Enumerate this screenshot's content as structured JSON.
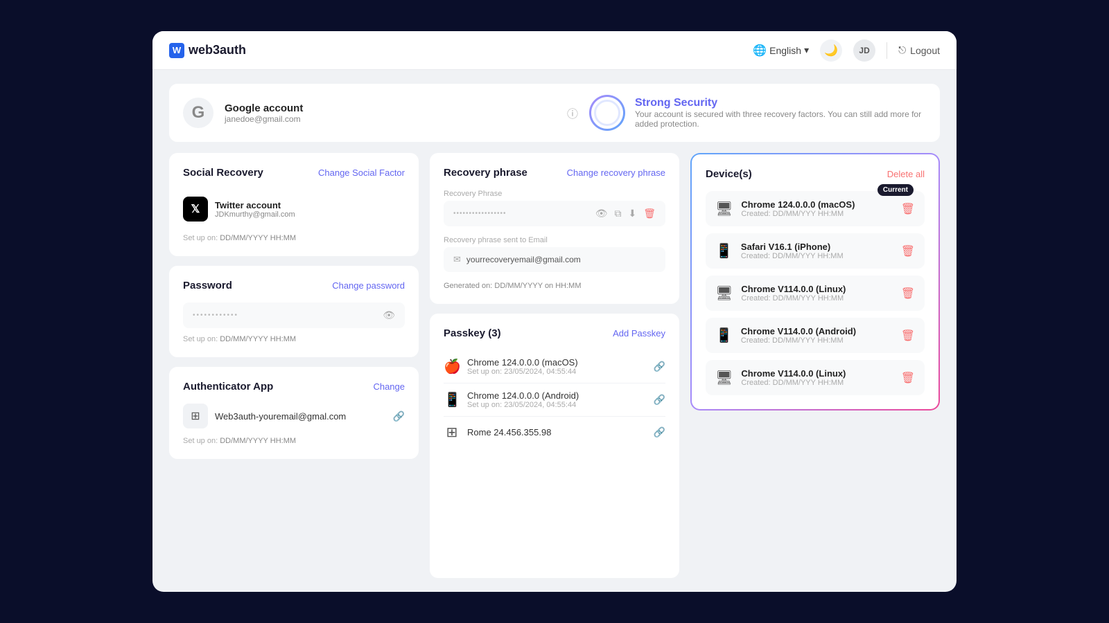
{
  "header": {
    "logo": "web3auth",
    "logo_letter": "W",
    "language": "English",
    "theme_icon": "🌙",
    "user_initials": "JD",
    "logout_label": "Logout"
  },
  "account": {
    "provider": "Google account",
    "email": "janedoe@gmail.com",
    "security_level": "Strong Security",
    "security_desc": "Your account is secured with three recovery factors. You can still add more for added protection."
  },
  "social_recovery": {
    "title": "Social Recovery",
    "action": "Change Social Factor",
    "account_type": "Twitter account",
    "account_email": "JDKmurthy@gmail.com",
    "setup_label": "Set up on:",
    "setup_date": "DD/MM/YYYY HH:MM"
  },
  "password": {
    "title": "Password",
    "action": "Change password",
    "dots": "••••••••••••",
    "setup_label": "Set up on:",
    "setup_date": "DD/MM/YYYY HH:MM"
  },
  "authenticator": {
    "title": "Authenticator App",
    "action": "Change",
    "email": "Web3auth-youremail@gmal.com",
    "setup_label": "Set up on:",
    "setup_date": "DD/MM/YYYY HH:MM"
  },
  "recovery_phrase": {
    "title": "Recovery phrase",
    "action": "Change recovery phrase",
    "phrase_label": "Recovery Phrase",
    "phrase_dots": "•••••••••••••••••",
    "email_label": "Recovery phrase sent to Email",
    "email_value": "yourrecoveryemail@gmail.com",
    "generated_label": "Generated on:",
    "generated_date": "DD/MM/YYYY on HH:MM"
  },
  "passkeys": {
    "title": "Passkey (3)",
    "action": "Add Passkey",
    "items": [
      {
        "name": "Chrome 124.0.0.0 (macOS)",
        "date": "Set up on: 23/05/2024, 04:55:44",
        "icon": "🍎"
      },
      {
        "name": "Chrome 124.0.0.0 (Android)",
        "date": "Set up on: 23/05/2024, 04:55:44",
        "icon": "📱"
      },
      {
        "name": "Rome 24.456.355.98",
        "date": "",
        "icon": "⊞"
      }
    ]
  },
  "devices": {
    "title": "Device(s)",
    "delete_all": "Delete all",
    "current_badge": "Current",
    "items": [
      {
        "name": "Chrome 124.0.0.0 (macOS)",
        "created": "Created: DD/MM/YYY HH:MM",
        "icon": "desktop",
        "current": true
      },
      {
        "name": "Safari V16.1 (iPhone)",
        "created": "Created: DD/MM/YYY HH:MM",
        "icon": "mobile",
        "current": false
      },
      {
        "name": "Chrome V114.0.0 (Linux)",
        "created": "Created: DD/MM/YYY HH:MM",
        "icon": "desktop",
        "current": false
      },
      {
        "name": "Chrome V114.0.0 (Android)",
        "created": "Created: DD/MM/YYY HH:MM",
        "icon": "mobile",
        "current": false
      },
      {
        "name": "Chrome V114.0.0 (Linux)",
        "created": "Created: DD/MM/YYY HH:MM",
        "icon": "desktop",
        "current": false
      }
    ]
  }
}
